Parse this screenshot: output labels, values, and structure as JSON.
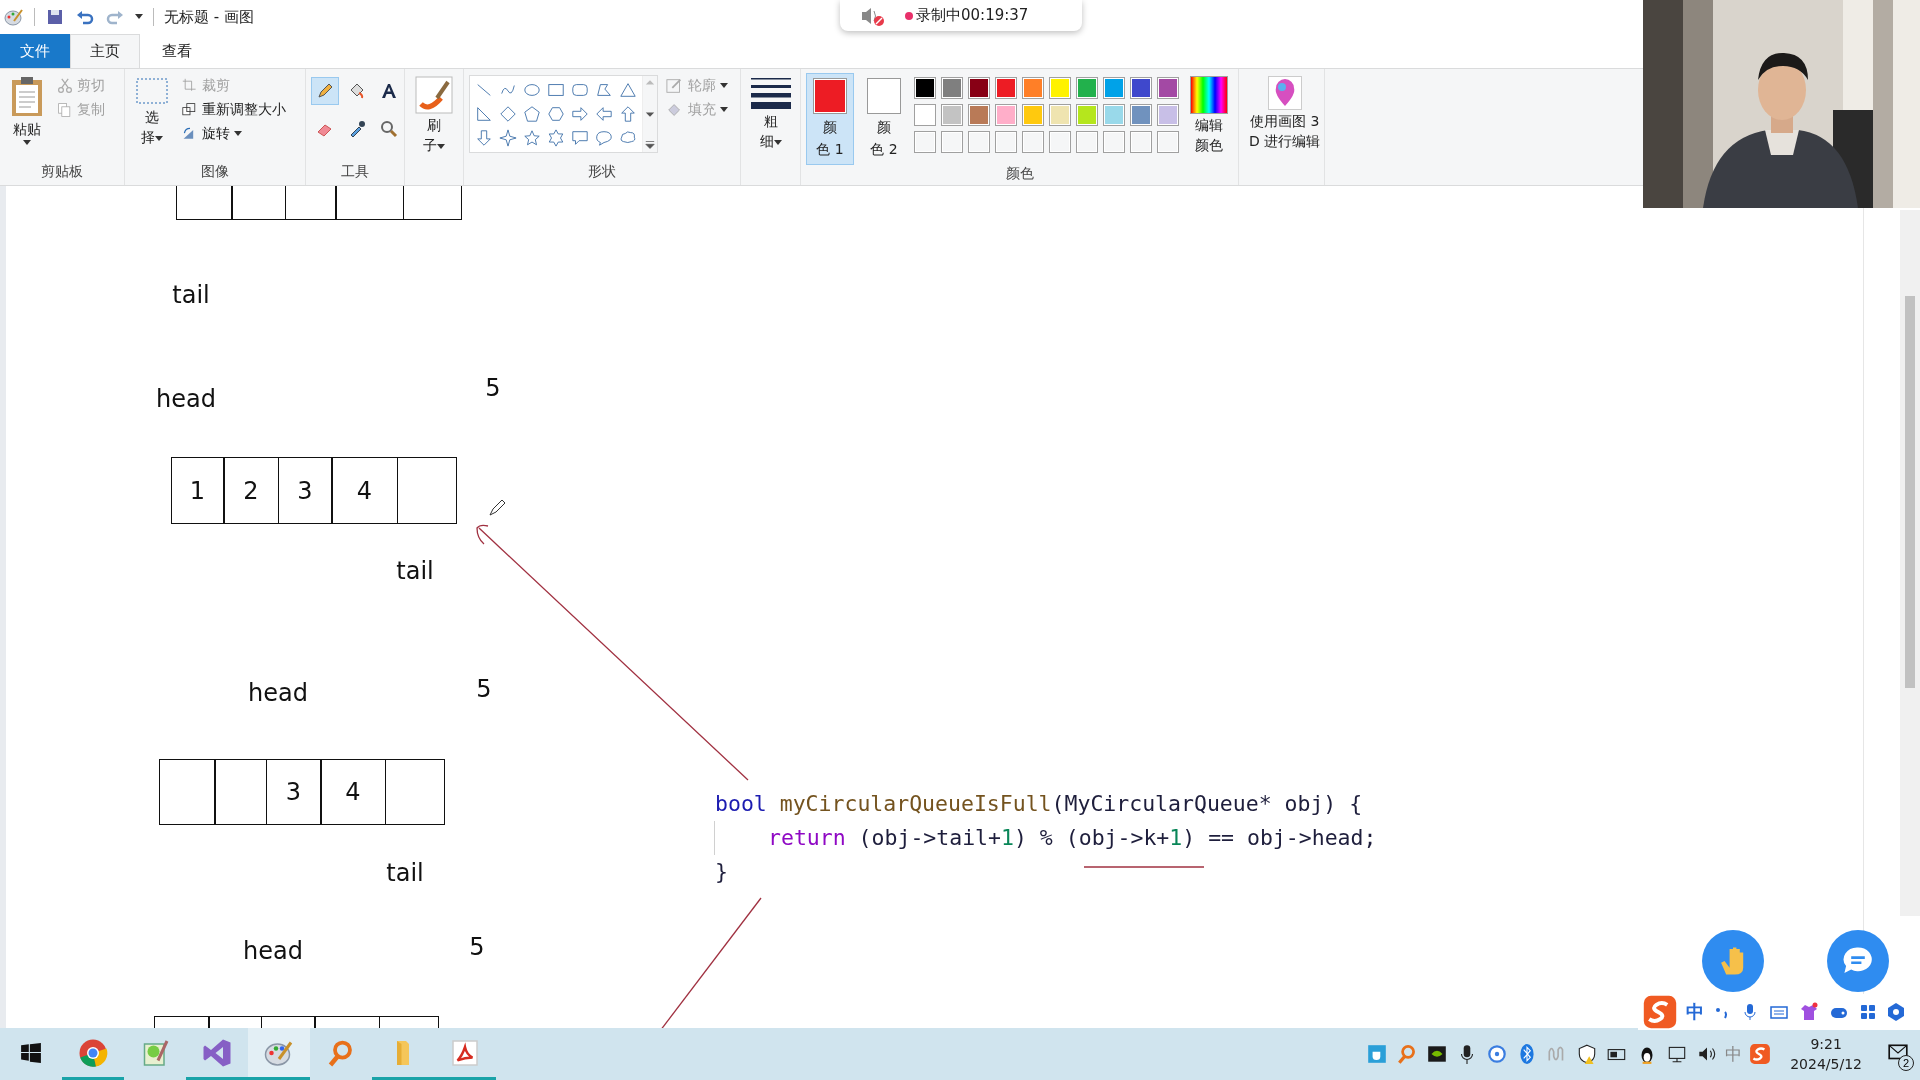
{
  "window": {
    "title": "无标题 - 画图"
  },
  "quick_access": [
    {
      "kind": "save",
      "disabled": false
    },
    {
      "kind": "undo",
      "disabled": false
    },
    {
      "kind": "redo",
      "disabled": true
    }
  ],
  "recording": {
    "muted": true,
    "text": "录制中00:19:37"
  },
  "tabs": [
    {
      "label": "文件",
      "kind": "file",
      "selected": false
    },
    {
      "label": "主页",
      "kind": "page",
      "selected": true
    },
    {
      "label": "查看",
      "kind": "page",
      "selected": false
    }
  ],
  "ribbon": {
    "clipboard": {
      "title": "剪贴板",
      "paste": "粘贴",
      "cut": {
        "label": "剪切",
        "disabled": true
      },
      "copy": {
        "label": "复制",
        "disabled": true
      }
    },
    "image": {
      "title": "图像",
      "select_lines": [
        "选",
        "择"
      ],
      "crop": {
        "label": "裁剪",
        "disabled": true
      },
      "resize": {
        "label": "重新调整大小",
        "disabled": false
      },
      "rotate": {
        "label": "旋转",
        "disabled": false
      }
    },
    "tools": {
      "title": "工具",
      "items": [
        {
          "kind": "pencil",
          "selected": true
        },
        {
          "kind": "fill",
          "selected": false
        },
        {
          "kind": "text",
          "selected": false
        },
        {
          "kind": "eraser",
          "selected": false
        },
        {
          "kind": "picker",
          "selected": false
        },
        {
          "kind": "magnifier",
          "selected": false
        }
      ]
    },
    "brushes": {
      "label_lines": [
        "刷",
        "子"
      ]
    },
    "shapes": {
      "title": "形状",
      "outline": {
        "label": "轮廓",
        "disabled": true
      },
      "fill": {
        "label": "填充",
        "disabled": true
      }
    },
    "size": {
      "label_lines": [
        "粗",
        "细"
      ]
    },
    "colors": {
      "title": "颜色",
      "slots": [
        {
          "label_lines": [
            "颜",
            "色 1"
          ],
          "color": "#ed1c24",
          "selected": true
        },
        {
          "label_lines": [
            "颜",
            "色 2"
          ],
          "color": "#ffffff",
          "selected": false
        }
      ],
      "palette": [
        {
          "color": "#000000"
        },
        {
          "color": "#7f7f7f"
        },
        {
          "color": "#880015"
        },
        {
          "color": "#ed1c24"
        },
        {
          "color": "#ff7f27"
        },
        {
          "color": "#fff200"
        },
        {
          "color": "#22b14c"
        },
        {
          "color": "#00a2e8"
        },
        {
          "color": "#3f48cc"
        },
        {
          "color": "#a349a4"
        },
        {
          "color": "#ffffff"
        },
        {
          "color": "#c3c3c3"
        },
        {
          "color": "#b97a57"
        },
        {
          "color": "#ffaec9"
        },
        {
          "color": "#ffc90e"
        },
        {
          "color": "#efe4b0"
        },
        {
          "color": "#b5e61d"
        },
        {
          "color": "#99d9ea"
        },
        {
          "color": "#7092be"
        },
        {
          "color": "#c8bfe7"
        },
        {
          "kind": "empty"
        },
        {
          "kind": "empty"
        },
        {
          "kind": "empty"
        },
        {
          "kind": "empty"
        },
        {
          "kind": "empty"
        },
        {
          "kind": "empty"
        },
        {
          "kind": "empty"
        },
        {
          "kind": "empty"
        },
        {
          "kind": "empty"
        },
        {
          "kind": "empty"
        }
      ],
      "edit_lines": [
        "编辑",
        "颜色"
      ]
    },
    "paint3d": {
      "label_lines": [
        "使用画图 3",
        "D 进行编辑"
      ]
    }
  },
  "canvas": {
    "labels": [
      {
        "text": "tail"
      },
      {
        "text": "head"
      },
      {
        "text": "5"
      },
      {
        "text": "tail"
      },
      {
        "text": "head"
      },
      {
        "text": "5"
      },
      {
        "text": "tail"
      },
      {
        "text": "head"
      },
      {
        "text": "5"
      }
    ],
    "box_rows": [
      {
        "cells": [
          {
            "kind": "empty"
          },
          {
            "kind": "empty"
          },
          {
            "kind": "empty"
          },
          {
            "kind": "empty"
          },
          {
            "kind": "empty"
          }
        ]
      },
      {
        "cells": [
          {
            "kind": "value",
            "text": "1"
          },
          {
            "kind": "value",
            "text": "2"
          },
          {
            "kind": "value",
            "text": "3"
          },
          {
            "kind": "value",
            "text": "4"
          },
          {
            "kind": "empty"
          }
        ]
      },
      {
        "cells": [
          {
            "kind": "empty"
          },
          {
            "kind": "empty"
          },
          {
            "kind": "value",
            "text": "3"
          },
          {
            "kind": "value",
            "text": "4"
          },
          {
            "kind": "empty"
          }
        ]
      },
      {
        "cells": [
          {
            "kind": "empty"
          },
          {
            "kind": "empty"
          },
          {
            "kind": "empty"
          },
          {
            "kind": "empty"
          },
          {
            "kind": "empty"
          }
        ]
      }
    ],
    "code_lines": [
      {
        "indented": false,
        "tokens": [
          {
            "kind": "keyword",
            "text": "bool"
          },
          {
            "kind": "function",
            "text": "myCircularQueueIsFull"
          },
          {
            "kind": "plain",
            "text": "(MyCircularQueue* obj) {"
          }
        ]
      },
      {
        "indented": true,
        "tokens": [
          {
            "kind": "control",
            "text": "return"
          },
          {
            "kind": "plain",
            "text": " (obj->tail+"
          },
          {
            "kind": "number",
            "text": "1"
          },
          {
            "kind": "plain",
            "text": ") % (obj->k+"
          },
          {
            "kind": "number",
            "text": "1"
          },
          {
            "kind": "plain",
            "text": ") == obj->head;"
          }
        ]
      },
      {
        "indented": false,
        "tokens": [
          {
            "kind": "plain",
            "text": "}"
          }
        ]
      }
    ]
  },
  "ime": {
    "mode": "中"
  },
  "taskbar": {
    "apps": [
      {
        "kind": "chrome",
        "running": true,
        "active": false
      },
      {
        "kind": "notepad",
        "running": false,
        "active": false
      },
      {
        "kind": "studio",
        "running": true,
        "active": false
      },
      {
        "kind": "paint",
        "running": true,
        "active": true
      },
      {
        "kind": "search",
        "running": false,
        "active": false
      },
      {
        "kind": "folder",
        "running": true,
        "active": false
      },
      {
        "kind": "pdf",
        "running": true,
        "active": false
      }
    ],
    "input_language": "中",
    "time": "9:21",
    "date": "2024/5/12",
    "notifications": "2"
  }
}
